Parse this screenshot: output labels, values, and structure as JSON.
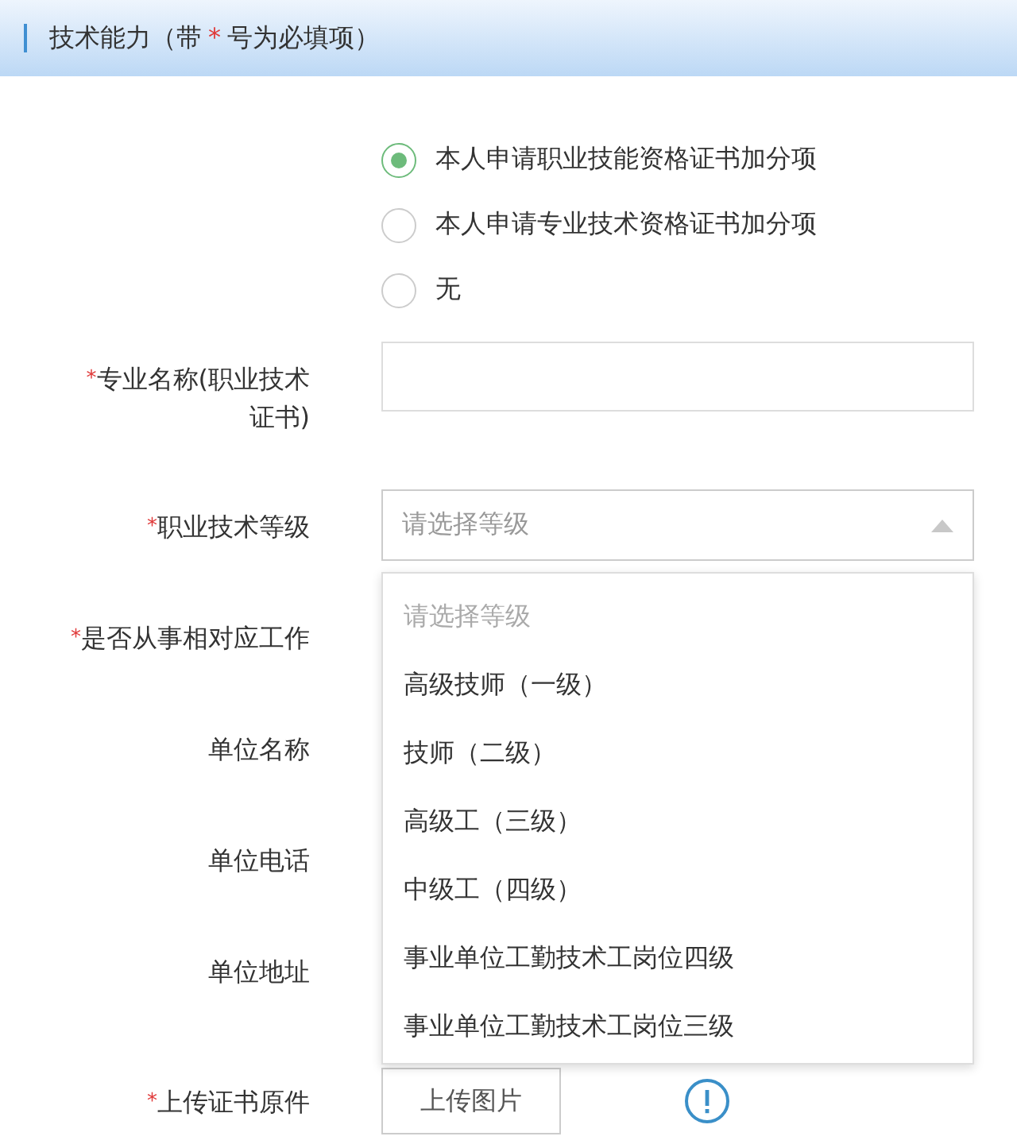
{
  "header": {
    "title_start": "技术能力（带",
    "title_mark": "*",
    "title_end": "号为必填项）"
  },
  "apply_options": [
    {
      "label": "本人申请职业技能资格证书加分项",
      "selected": true
    },
    {
      "label": "本人申请专业技术资格证书加分项",
      "selected": false
    },
    {
      "label": "无",
      "selected": false
    }
  ],
  "fields": [
    {
      "kind": "text",
      "mark": "*",
      "label": "专业名称(职业技术证书)"
    },
    {
      "kind": "select",
      "mark": "*",
      "label": "职业技术等级",
      "placeholder": "请选择等级",
      "expanded": true,
      "options": [
        {
          "label": "请选择等级",
          "kind": "placeholder"
        },
        {
          "label": "高级技师（一级）",
          "kind": "option"
        },
        {
          "label": "技师（二级）",
          "kind": "option"
        },
        {
          "label": "高级工（三级）",
          "kind": "option"
        },
        {
          "label": "中级工（四级）",
          "kind": "option"
        },
        {
          "label": "事业单位工勤技术工岗位四级",
          "kind": "option"
        },
        {
          "label": "事业单位工勤技术工岗位三级",
          "kind": "option"
        }
      ]
    },
    {
      "kind": "hidden",
      "mark": "*",
      "label": "是否从事相对应工作"
    },
    {
      "kind": "hidden",
      "label": "单位名称"
    },
    {
      "kind": "hidden",
      "label": "单位电话"
    },
    {
      "kind": "hidden",
      "label": "单位地址"
    },
    {
      "kind": "upload",
      "mark": "*",
      "label": "上传证书原件",
      "button": "上传图片"
    }
  ]
}
